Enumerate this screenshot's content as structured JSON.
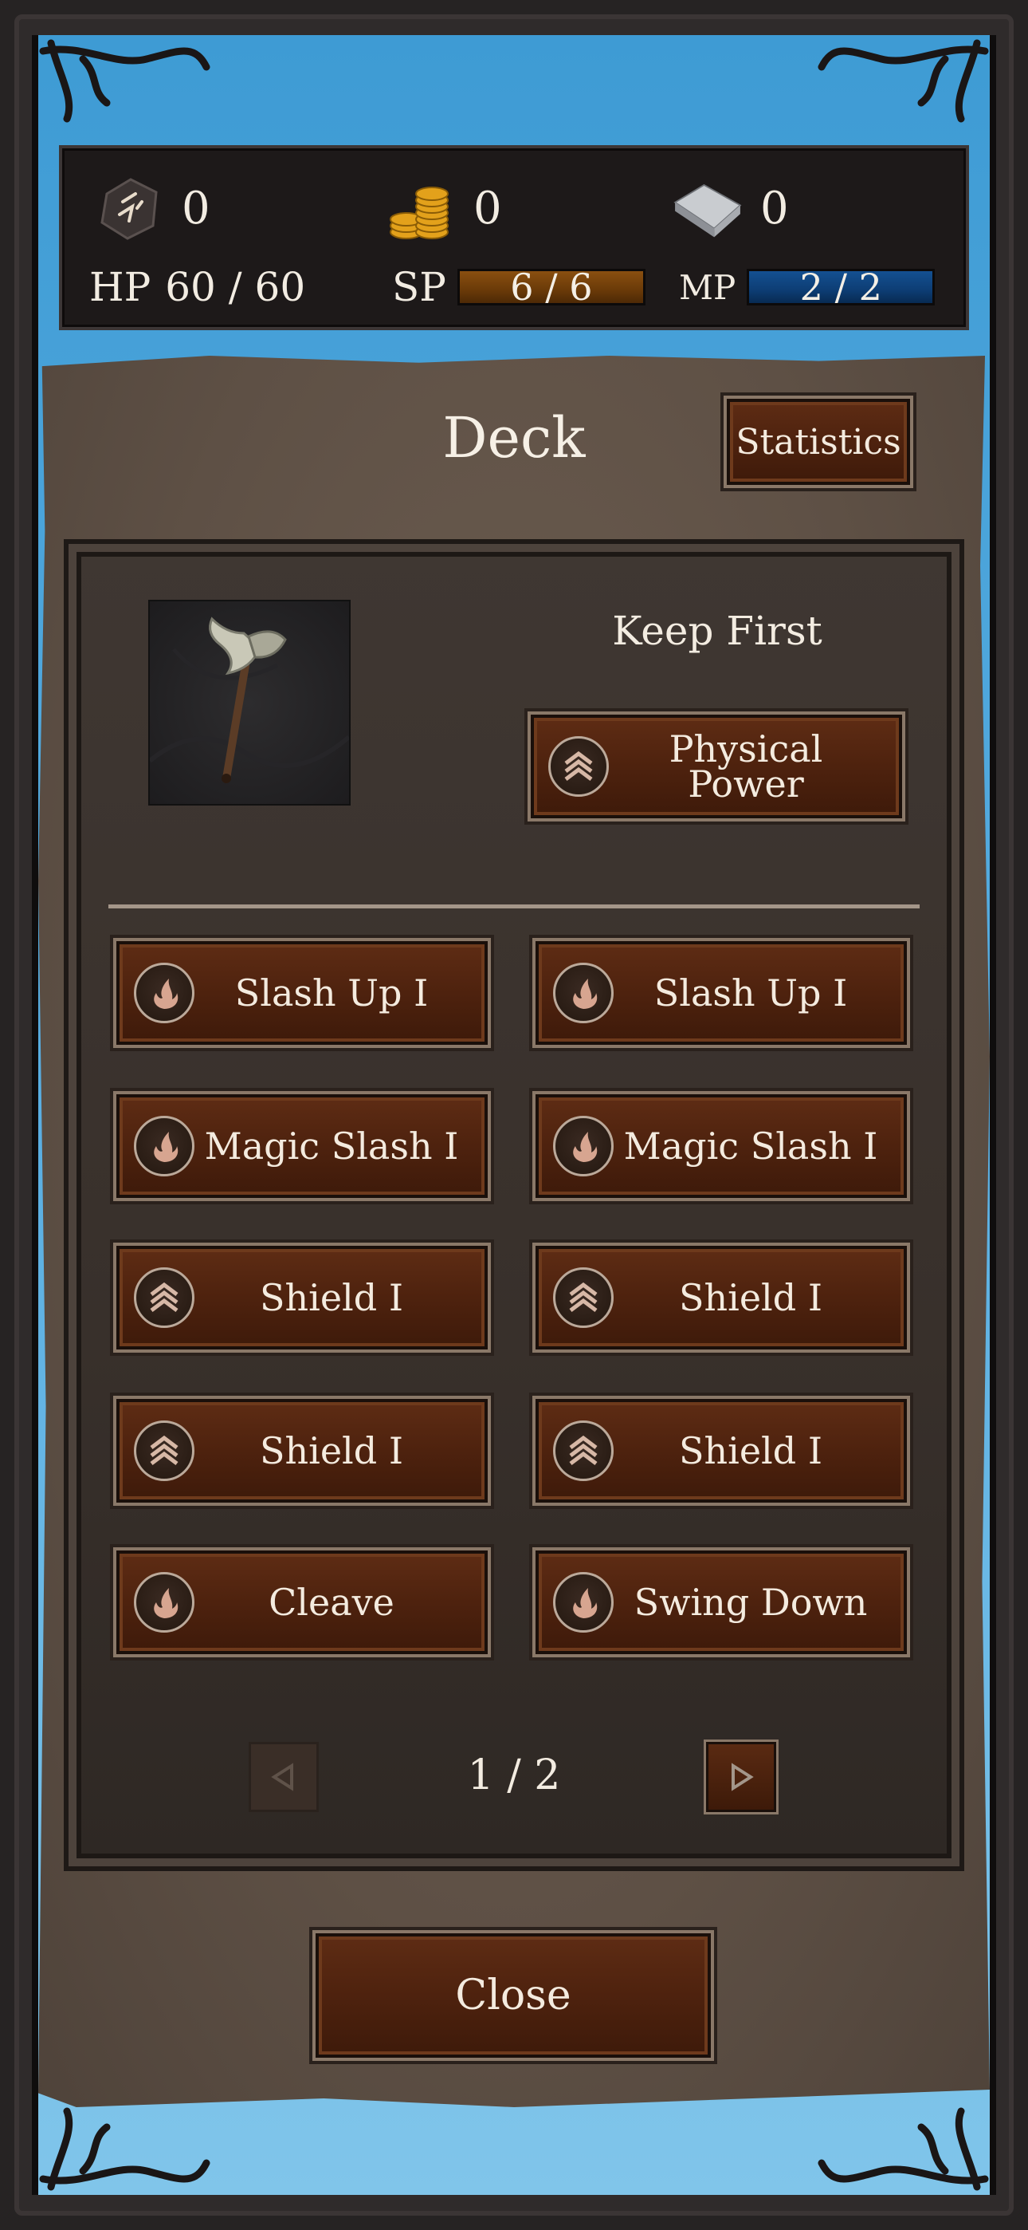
{
  "resources": {
    "runes": {
      "icon": "rune-stone-icon",
      "value": "0"
    },
    "gold": {
      "icon": "gold-coins-icon",
      "value": "0"
    },
    "ingot": {
      "icon": "silver-ingot-icon",
      "value": "0"
    }
  },
  "stats": {
    "hp": {
      "label": "HP",
      "text": "60 / 60",
      "current": 60,
      "max": 60
    },
    "sp": {
      "label": "SP",
      "text": "6 / 6",
      "current": 6,
      "max": 6
    },
    "mp": {
      "label": "MP",
      "text": "2 / 2",
      "current": 2,
      "max": 2
    }
  },
  "deck": {
    "title": "Deck",
    "statistics_label": "Statistics",
    "weapon_icon": "battle-axe-icon",
    "keep_first_label": "Keep First",
    "keep_first_card": {
      "label": "Physical\nPower",
      "icon": "chevron-up-icon"
    },
    "cards": [
      {
        "label": "Slash Up I",
        "icon": "flame-slash-icon"
      },
      {
        "label": "Slash Up I",
        "icon": "flame-slash-icon"
      },
      {
        "label": "Magic Slash I",
        "icon": "flame-slash-icon"
      },
      {
        "label": "Magic Slash I",
        "icon": "flame-slash-icon"
      },
      {
        "label": "Shield I",
        "icon": "chevron-up-icon"
      },
      {
        "label": "Shield I",
        "icon": "chevron-up-icon"
      },
      {
        "label": "Shield I",
        "icon": "chevron-up-icon"
      },
      {
        "label": "Shield I",
        "icon": "chevron-up-icon"
      },
      {
        "label": "Cleave",
        "icon": "flame-slash-icon"
      },
      {
        "label": "Swing Down",
        "icon": "flame-slash-icon"
      }
    ],
    "pagination": {
      "text": "1 / 2",
      "prev_icon": "triangle-left-icon",
      "next_icon": "triangle-right-icon"
    },
    "close_label": "Close"
  },
  "colors": {
    "sky": "#4aa3db",
    "wood_button": "#4e220e",
    "sp_bar": "#8a4f10",
    "mp_bar": "#145091",
    "parchment": "#5e5045"
  }
}
